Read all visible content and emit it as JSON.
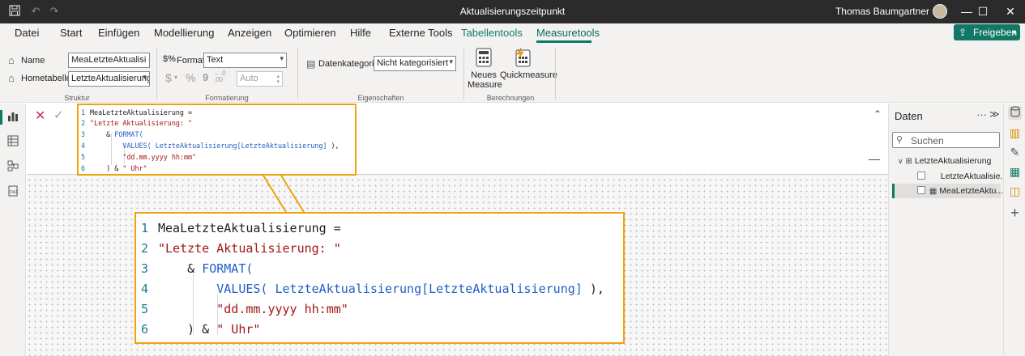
{
  "titlebar": {
    "title": "Aktualisierungszeitpunkt",
    "user": "Thomas Baumgartner",
    "icons": [
      "save-icon",
      "undo-icon",
      "redo-icon"
    ],
    "window_controls": [
      "minimize-icon",
      "maximize-icon",
      "close-icon"
    ]
  },
  "menu": {
    "tabs": [
      "Datei",
      "Start",
      "Einfügen",
      "Modellierung",
      "Anzeigen",
      "Optimieren",
      "Hilfe",
      "Externe Tools",
      "Tabellentools",
      "Measuretools"
    ],
    "active_tab": "Measuretools",
    "share_label": "Freigeben"
  },
  "ribbon": {
    "struktur": {
      "label": "Struktur",
      "name_label": "Name",
      "name_value": "MeaLetzteAktualisi",
      "hometable_label": "Hometabelle",
      "hometable_value": "LetzteAktualisierung"
    },
    "formatierung": {
      "label": "Formatierung",
      "format_label": "Format",
      "format_value": "Text",
      "currency": "$",
      "percent": "%",
      "comma": "9",
      "decimals": "Auto"
    },
    "eigenschaften": {
      "label": "Eigenschaften",
      "datacategory_label": "Datenkategorie",
      "datacategory_value": "Nicht kategorisiert"
    },
    "berechnungen": {
      "label": "Berechnungen",
      "new_measure_line1": "Neues",
      "new_measure_line2": "Measure",
      "quick_measure": "Quickmeasure"
    }
  },
  "code": {
    "lines": [
      {
        "n": "1",
        "indent": "",
        "parts": [
          {
            "t": "MeaLetzteAktualisierung =",
            "c": "plain"
          }
        ]
      },
      {
        "n": "2",
        "indent": "",
        "parts": [
          {
            "t": "\"Letzte Aktualisierung: \"",
            "c": "str"
          }
        ]
      },
      {
        "n": "3",
        "indent": "    ",
        "parts": [
          {
            "t": "& ",
            "c": "plain"
          },
          {
            "t": "FORMAT(",
            "c": "kw"
          }
        ]
      },
      {
        "n": "4",
        "indent": "        ",
        "parts": [
          {
            "t": "VALUES( ",
            "c": "kw"
          },
          {
            "t": "LetzteAktualisierung",
            "c": "kw"
          },
          {
            "t": "[LetzteAktualisierung]",
            "c": "kw"
          },
          {
            "t": " ),",
            "c": "plain"
          }
        ]
      },
      {
        "n": "5",
        "indent": "        ",
        "parts": [
          {
            "t": "\"dd.mm.yyyy hh:mm\"",
            "c": "str"
          }
        ]
      },
      {
        "n": "6",
        "indent": "    ",
        "parts": [
          {
            "t": ") & ",
            "c": "plain"
          },
          {
            "t": "\" Uhr\"",
            "c": "str"
          }
        ]
      }
    ]
  },
  "datapane": {
    "title": "Daten",
    "search_placeholder": "Suchen",
    "table_name": "LetzteAktualisierung",
    "fields": [
      "LetzteAktualisie...",
      "MeaLetzteAktu..."
    ]
  },
  "colors": {
    "accent": "#117865",
    "highlight_border": "#f0a30a",
    "keyword": "#1f5fc4",
    "string": "#a31515"
  }
}
